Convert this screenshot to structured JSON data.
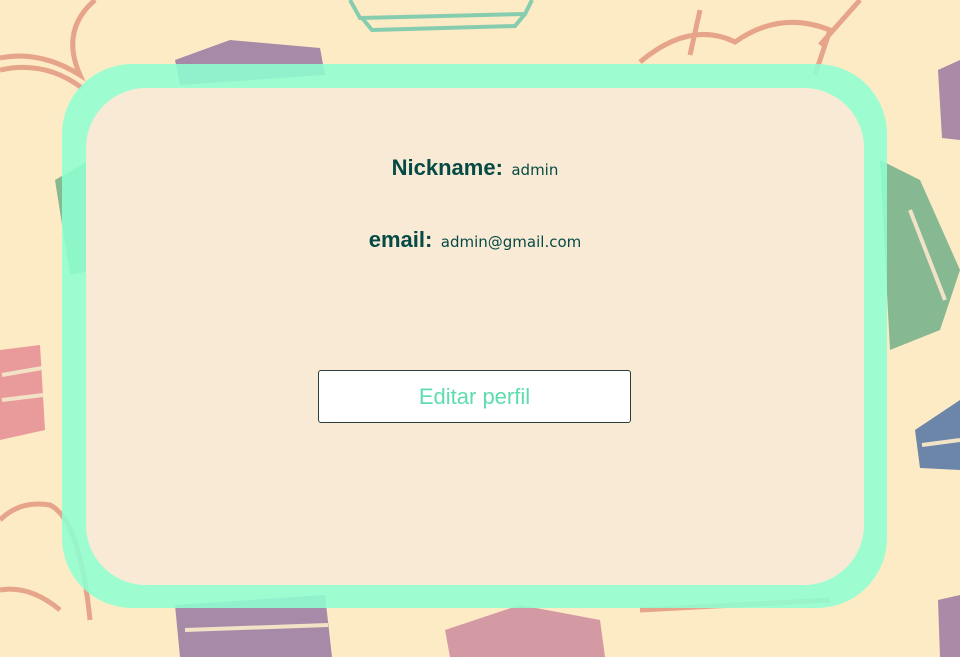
{
  "profile": {
    "nickname_label": "Nickname:",
    "nickname_value": "admin",
    "email_label": "email:",
    "email_value": "admin@gmail.com"
  },
  "actions": {
    "edit_profile_label": "Editar perfil"
  },
  "colors": {
    "background": "#fdebc6",
    "frame": "#8fffd2",
    "card": "#f9ead6",
    "text": "#064a45",
    "button_text": "#5fdcae"
  },
  "background_icons": [
    "book-icon",
    "open-book-icon",
    "book-stack-icon"
  ]
}
